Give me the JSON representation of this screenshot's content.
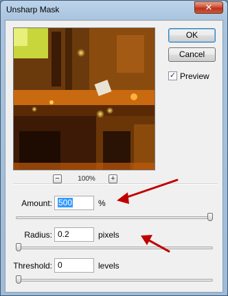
{
  "window": {
    "title": "Unsharp Mask",
    "close_glyph": "✕"
  },
  "buttons": {
    "ok_label": "OK",
    "cancel_label": "Cancel"
  },
  "preview_toggle": {
    "label": "Preview",
    "checked": true
  },
  "zoom": {
    "minus": "−",
    "plus": "+",
    "level": "100%"
  },
  "params": {
    "amount": {
      "label": "Amount:",
      "value": "500",
      "unit": "%",
      "slider_fraction": 1.0
    },
    "radius": {
      "label": "Radius:",
      "value": "0.2",
      "unit": "pixels",
      "slider_fraction": 0.0
    },
    "threshold": {
      "label": "Threshold:",
      "value": "0",
      "unit": "levels",
      "slider_fraction": 0.0
    }
  },
  "annotations": {
    "arrow_color": "#c00000"
  },
  "colors": {
    "title_bar": "#a9c3de",
    "close_button": "#c9442a",
    "selection": "#3399ff"
  }
}
